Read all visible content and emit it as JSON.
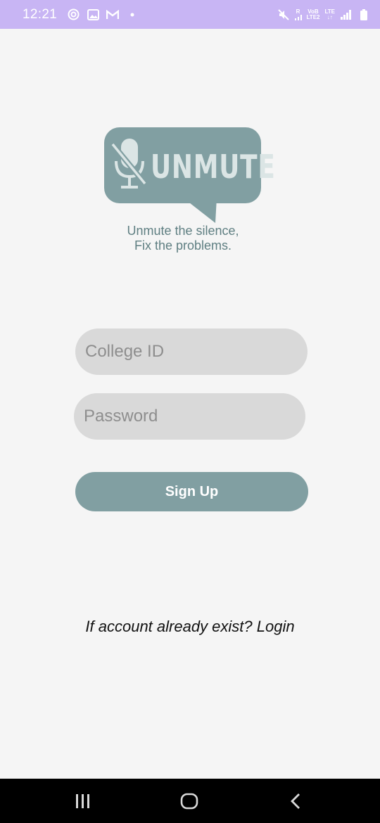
{
  "status_bar": {
    "time": "12:21",
    "network_volte": "VoB",
    "network_lte2": "LTE2",
    "network_lte": "LTE",
    "network_arrows": "↓↑",
    "sim_r": "R"
  },
  "logo": {
    "wordmark": "UNMUTE"
  },
  "tagline": {
    "line1": "Unmute the silence,",
    "line2": "Fix the problems."
  },
  "form": {
    "college_id_placeholder": "College ID",
    "password_placeholder": "Password",
    "signup_label": "Sign Up"
  },
  "footer": {
    "login_prompt": "If account already exist? Login"
  },
  "colors": {
    "accent": "#819fa2",
    "status_bar": "#c8b5f4",
    "field_bg": "#d9d9d9",
    "background": "#f5f5f5"
  }
}
